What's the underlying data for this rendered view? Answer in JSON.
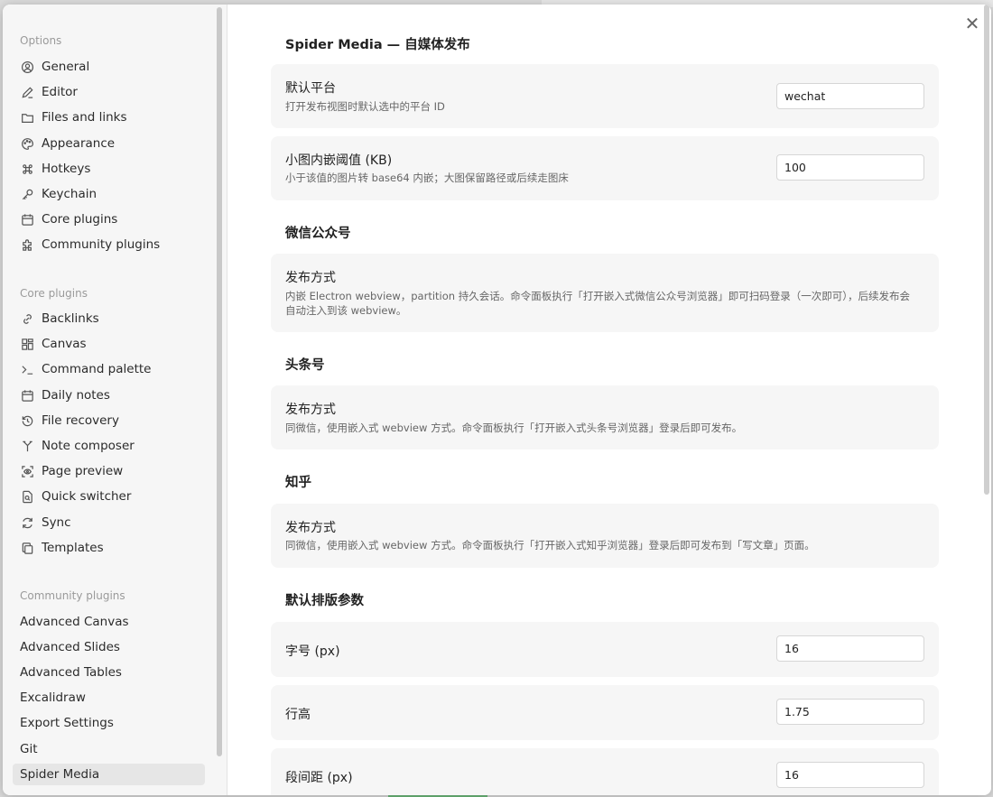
{
  "sidebar": {
    "options_title": "Options",
    "options": [
      {
        "label": "General",
        "icon": "user-circle-icon"
      },
      {
        "label": "Editor",
        "icon": "pencil-icon"
      },
      {
        "label": "Files and links",
        "icon": "folder-icon"
      },
      {
        "label": "Appearance",
        "icon": "palette-icon"
      },
      {
        "label": "Hotkeys",
        "icon": "command-icon"
      },
      {
        "label": "Keychain",
        "icon": "key-icon"
      },
      {
        "label": "Core plugins",
        "icon": "calendar-plugins-icon"
      },
      {
        "label": "Community plugins",
        "icon": "puzzle-icon"
      }
    ],
    "core_title": "Core plugins",
    "core": [
      {
        "label": "Backlinks",
        "icon": "link-icon"
      },
      {
        "label": "Canvas",
        "icon": "canvas-icon"
      },
      {
        "label": "Command palette",
        "icon": "terminal-icon"
      },
      {
        "label": "Daily notes",
        "icon": "calendar-icon"
      },
      {
        "label": "File recovery",
        "icon": "history-icon"
      },
      {
        "label": "Note composer",
        "icon": "merge-icon"
      },
      {
        "label": "Page preview",
        "icon": "eye-scan-icon"
      },
      {
        "label": "Quick switcher",
        "icon": "file-search-icon"
      },
      {
        "label": "Sync",
        "icon": "refresh-icon"
      },
      {
        "label": "Templates",
        "icon": "copy-icon"
      }
    ],
    "community_title": "Community plugins",
    "community": [
      {
        "label": "Advanced Canvas"
      },
      {
        "label": "Advanced Slides"
      },
      {
        "label": "Advanced Tables"
      },
      {
        "label": "Excalidraw"
      },
      {
        "label": "Export Settings"
      },
      {
        "label": "Git"
      },
      {
        "label": "Spider Media",
        "active": true
      }
    ]
  },
  "content": {
    "title": "Spider Media — 自媒体发布",
    "default_platform": {
      "name": "默认平台",
      "desc": "打开发布视图时默认选中的平台 ID",
      "value": "wechat"
    },
    "inline_threshold": {
      "name": "小图内嵌阈值 (KB)",
      "desc": "小于该值的图片转 base64 内嵌；大图保留路径或后续走图床",
      "value": "100"
    },
    "wechat_heading": "微信公众号",
    "wechat_method": {
      "name": "发布方式",
      "desc": "内嵌 Electron webview，partition 持久会话。命令面板执行「打开嵌入式微信公众号浏览器」即可扫码登录（一次即可），后续发布会自动注入到该 webview。"
    },
    "toutiao_heading": "头条号",
    "toutiao_method": {
      "name": "发布方式",
      "desc": "同微信，使用嵌入式 webview 方式。命令面板执行「打开嵌入式头条号浏览器」登录后即可发布。"
    },
    "zhihu_heading": "知乎",
    "zhihu_method": {
      "name": "发布方式",
      "desc": "同微信，使用嵌入式 webview 方式。命令面板执行「打开嵌入式知乎浏览器」登录后即可发布到「写文章」页面。"
    },
    "layout_heading": "默认排版参数",
    "font_size": {
      "name": "字号 (px)",
      "value": "16"
    },
    "line_height": {
      "name": "行高",
      "value": "1.75"
    },
    "para_spacing": {
      "name": "段间距 (px)",
      "value": "16"
    }
  }
}
